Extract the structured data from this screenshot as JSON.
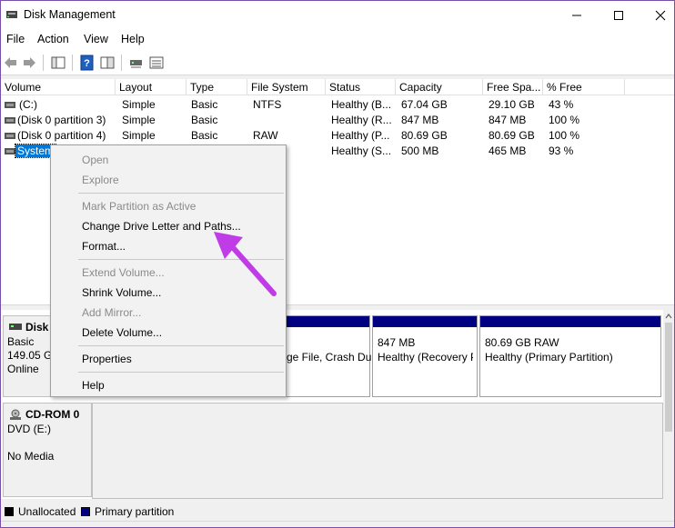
{
  "window": {
    "title": "Disk Management",
    "accent": "#7a4fa8"
  },
  "menubar": [
    "File",
    "Action",
    "View",
    "Help"
  ],
  "toolbar": {
    "buttons": [
      "back-arrow-icon",
      "forward-arrow-icon",
      "console-tree-icon",
      "help-icon",
      "properties-pane-icon",
      "disk-icon",
      "list-icon"
    ]
  },
  "volume_list": {
    "columns": [
      "Volume",
      "Layout",
      "Type",
      "File System",
      "Status",
      "Capacity",
      "Free Spa...",
      "% Free"
    ],
    "rows": [
      {
        "volume": "(C:)",
        "layout": "Simple",
        "type": "Basic",
        "fs": "NTFS",
        "status": "Healthy (B...",
        "capacity": "67.04 GB",
        "free": "29.10 GB",
        "pct": "43 %"
      },
      {
        "volume": "(Disk 0 partition 3)",
        "layout": "Simple",
        "type": "Basic",
        "fs": "",
        "status": "Healthy (R...",
        "capacity": "847 MB",
        "free": "847 MB",
        "pct": "100 %"
      },
      {
        "volume": "(Disk 0 partition 4)",
        "layout": "Simple",
        "type": "Basic",
        "fs": "RAW",
        "status": "Healthy (P...",
        "capacity": "80.69 GB",
        "free": "80.69 GB",
        "pct": "100 %"
      },
      {
        "volume": "System",
        "layout": "",
        "type": "",
        "fs": "",
        "status": "Healthy (S...",
        "capacity": "500 MB",
        "free": "465 MB",
        "pct": "93 %"
      }
    ],
    "selected_color": "#0078d7"
  },
  "context_menu": {
    "items": [
      {
        "label": "Open",
        "enabled": false
      },
      {
        "label": "Explore",
        "enabled": false
      },
      {
        "label": "Mark Partition as Active",
        "enabled": false
      },
      {
        "label": "Change Drive Letter and Paths...",
        "enabled": true
      },
      {
        "label": "Format...",
        "enabled": true
      },
      {
        "label": "Extend Volume...",
        "enabled": false
      },
      {
        "label": "Shrink Volume...",
        "enabled": true
      },
      {
        "label": "Add Mirror...",
        "enabled": false
      },
      {
        "label": "Delete Volume...",
        "enabled": true
      },
      {
        "label": "Properties",
        "enabled": true
      },
      {
        "label": "Help",
        "enabled": true
      }
    ],
    "arrow_color": "#c03ce6"
  },
  "disks": {
    "disk0": {
      "name": "Disk (",
      "type": "Basic",
      "size": "149.05 GB",
      "state": "Online"
    },
    "partitions": [
      {
        "line1": "",
        "line2": "ge File, Crash Du"
      },
      {
        "line1": "847 MB",
        "line2": "Healthy (Recovery P"
      },
      {
        "line1": "80.69 GB RAW",
        "line2": "Healthy (Primary Partition)"
      }
    ],
    "cdrom": {
      "name": "CD-ROM 0",
      "drive": "DVD (E:)",
      "media": "No Media"
    },
    "primary_color": "#000080"
  },
  "legend": {
    "unallocated": "Unallocated",
    "primary": "Primary partition"
  }
}
